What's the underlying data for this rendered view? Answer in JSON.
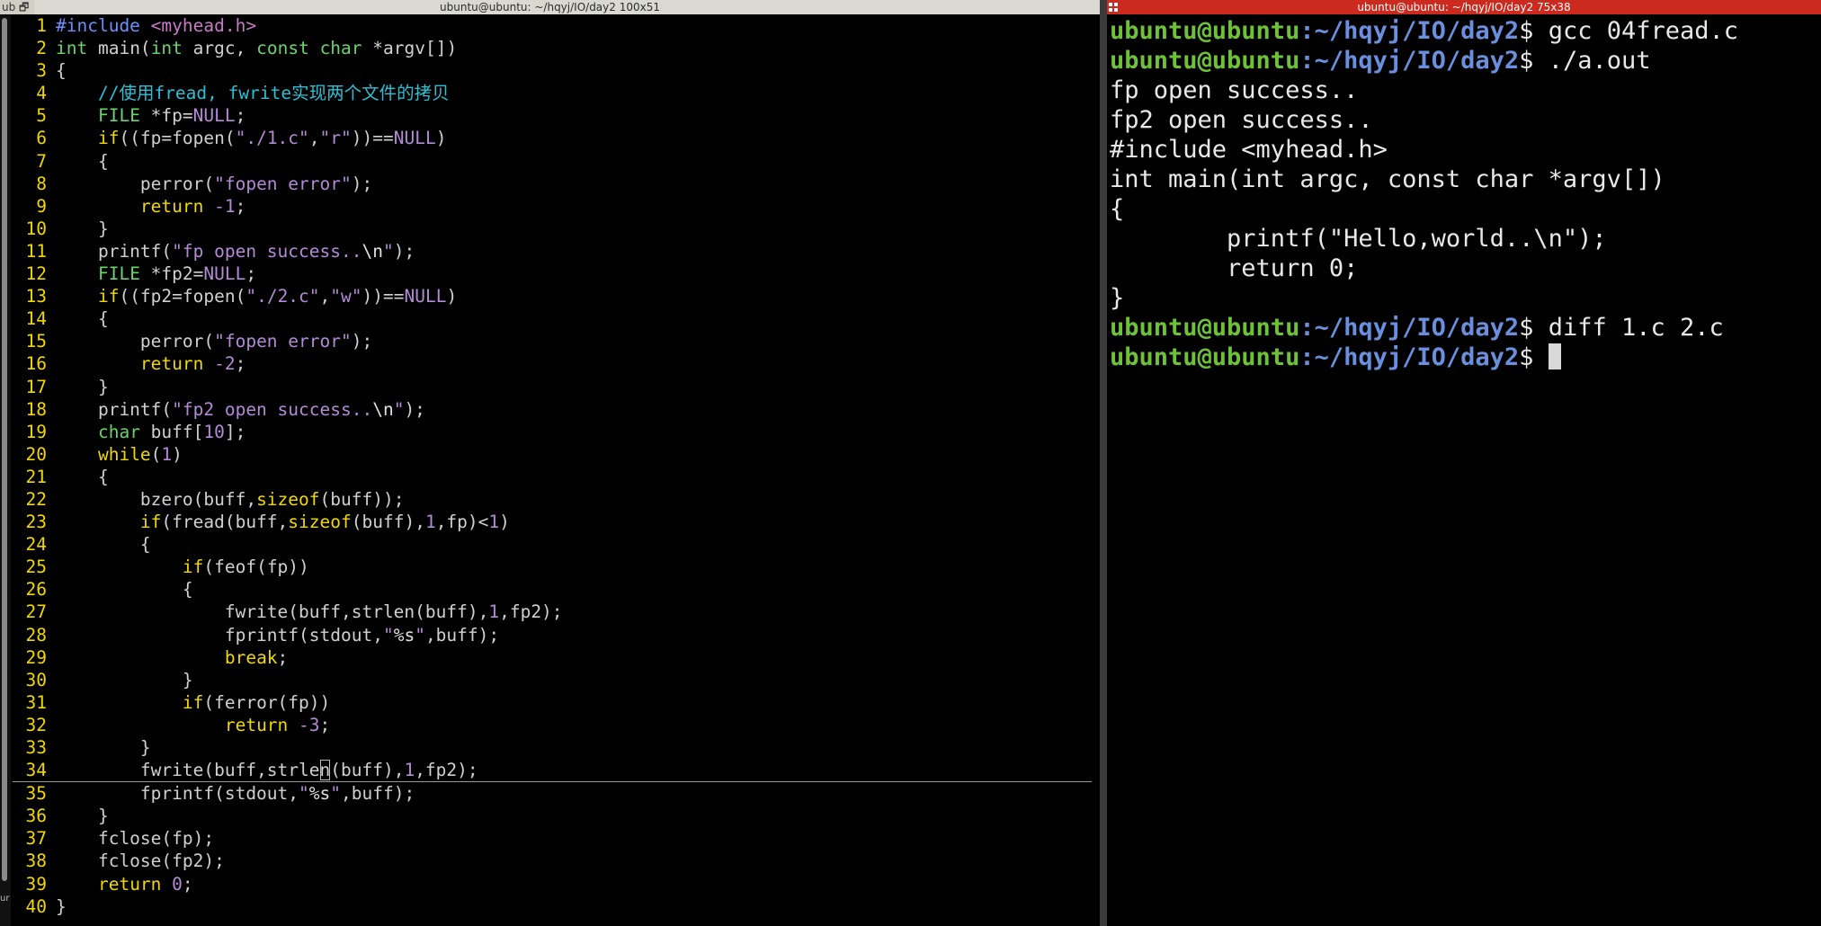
{
  "left_window": {
    "title": "ubuntu@ubuntu: ~/hqyj/IO/day2 100x51",
    "corner_label": "ub 🗗",
    "side_label": "ur",
    "lines": [
      [
        {
          "t": "#include ",
          "c": "pre"
        },
        {
          "t": "<myhead.h>",
          "c": "inc"
        }
      ],
      [
        {
          "t": "int",
          "c": "typ"
        },
        {
          "t": " main(",
          "c": ""
        },
        {
          "t": "int",
          "c": "typ"
        },
        {
          "t": " argc, ",
          "c": ""
        },
        {
          "t": "const",
          "c": "typ"
        },
        {
          "t": " ",
          "c": ""
        },
        {
          "t": "char",
          "c": "typ"
        },
        {
          "t": " *argv[])",
          "c": ""
        }
      ],
      [
        {
          "t": "{",
          "c": ""
        }
      ],
      [
        {
          "t": "    ",
          "c": ""
        },
        {
          "t": "//使用fread, fwrite实现两个文件的拷贝",
          "c": "cmt"
        }
      ],
      [
        {
          "t": "    ",
          "c": ""
        },
        {
          "t": "FILE",
          "c": "typ"
        },
        {
          "t": " *fp=",
          "c": ""
        },
        {
          "t": "NULL",
          "c": "num"
        },
        {
          "t": ";",
          "c": ""
        }
      ],
      [
        {
          "t": "    ",
          "c": ""
        },
        {
          "t": "if",
          "c": "kw"
        },
        {
          "t": "((fp=fopen(",
          "c": ""
        },
        {
          "t": "\"./1.c\"",
          "c": "str"
        },
        {
          "t": ",",
          "c": ""
        },
        {
          "t": "\"r\"",
          "c": "str"
        },
        {
          "t": "))==",
          "c": ""
        },
        {
          "t": "NULL",
          "c": "num"
        },
        {
          "t": ")",
          "c": ""
        }
      ],
      [
        {
          "t": "    {",
          "c": ""
        }
      ],
      [
        {
          "t": "        perror(",
          "c": ""
        },
        {
          "t": "\"fopen error\"",
          "c": "str"
        },
        {
          "t": ");",
          "c": ""
        }
      ],
      [
        {
          "t": "        ",
          "c": ""
        },
        {
          "t": "return",
          "c": "kw"
        },
        {
          "t": " ",
          "c": ""
        },
        {
          "t": "-1",
          "c": "num"
        },
        {
          "t": ";",
          "c": ""
        }
      ],
      [
        {
          "t": "    }",
          "c": ""
        }
      ],
      [
        {
          "t": "    printf(",
          "c": ""
        },
        {
          "t": "\"fp open success..",
          "c": "str"
        },
        {
          "t": "\\n",
          "c": "esc"
        },
        {
          "t": "\"",
          "c": "str"
        },
        {
          "t": ");",
          "c": ""
        }
      ],
      [
        {
          "t": "    ",
          "c": ""
        },
        {
          "t": "FILE",
          "c": "typ"
        },
        {
          "t": " *fp2=",
          "c": ""
        },
        {
          "t": "NULL",
          "c": "num"
        },
        {
          "t": ";",
          "c": ""
        }
      ],
      [
        {
          "t": "    ",
          "c": ""
        },
        {
          "t": "if",
          "c": "kw"
        },
        {
          "t": "((fp2=fopen(",
          "c": ""
        },
        {
          "t": "\"./2.c\"",
          "c": "str"
        },
        {
          "t": ",",
          "c": ""
        },
        {
          "t": "\"w\"",
          "c": "str"
        },
        {
          "t": "))==",
          "c": ""
        },
        {
          "t": "NULL",
          "c": "num"
        },
        {
          "t": ")",
          "c": ""
        }
      ],
      [
        {
          "t": "    {",
          "c": ""
        }
      ],
      [
        {
          "t": "        perror(",
          "c": ""
        },
        {
          "t": "\"fopen error\"",
          "c": "str"
        },
        {
          "t": ");",
          "c": ""
        }
      ],
      [
        {
          "t": "        ",
          "c": ""
        },
        {
          "t": "return",
          "c": "kw"
        },
        {
          "t": " ",
          "c": ""
        },
        {
          "t": "-2",
          "c": "num"
        },
        {
          "t": ";",
          "c": ""
        }
      ],
      [
        {
          "t": "    }",
          "c": ""
        }
      ],
      [
        {
          "t": "    printf(",
          "c": ""
        },
        {
          "t": "\"fp2 open success..",
          "c": "str"
        },
        {
          "t": "\\n",
          "c": "esc"
        },
        {
          "t": "\"",
          "c": "str"
        },
        {
          "t": ");",
          "c": ""
        }
      ],
      [
        {
          "t": "    ",
          "c": ""
        },
        {
          "t": "char",
          "c": "typ"
        },
        {
          "t": " buff[",
          "c": ""
        },
        {
          "t": "10",
          "c": "num"
        },
        {
          "t": "];",
          "c": ""
        }
      ],
      [
        {
          "t": "    ",
          "c": ""
        },
        {
          "t": "while",
          "c": "kw"
        },
        {
          "t": "(",
          "c": ""
        },
        {
          "t": "1",
          "c": "num"
        },
        {
          "t": ")",
          "c": ""
        }
      ],
      [
        {
          "t": "    {",
          "c": ""
        }
      ],
      [
        {
          "t": "        bzero(buff,",
          "c": ""
        },
        {
          "t": "sizeof",
          "c": "kw"
        },
        {
          "t": "(buff));",
          "c": ""
        }
      ],
      [
        {
          "t": "        ",
          "c": ""
        },
        {
          "t": "if",
          "c": "kw"
        },
        {
          "t": "(fread(buff,",
          "c": ""
        },
        {
          "t": "sizeof",
          "c": "kw"
        },
        {
          "t": "(buff),",
          "c": ""
        },
        {
          "t": "1",
          "c": "num"
        },
        {
          "t": ",fp)<",
          "c": ""
        },
        {
          "t": "1",
          "c": "num"
        },
        {
          "t": ")",
          "c": ""
        }
      ],
      [
        {
          "t": "        {",
          "c": ""
        }
      ],
      [
        {
          "t": "            ",
          "c": ""
        },
        {
          "t": "if",
          "c": "kw"
        },
        {
          "t": "(feof(fp))",
          "c": ""
        }
      ],
      [
        {
          "t": "            {",
          "c": ""
        }
      ],
      [
        {
          "t": "                fwrite(buff,strlen(buff),",
          "c": ""
        },
        {
          "t": "1",
          "c": "num"
        },
        {
          "t": ",fp2);",
          "c": ""
        }
      ],
      [
        {
          "t": "                fprintf(stdout,",
          "c": ""
        },
        {
          "t": "\"",
          "c": "str"
        },
        {
          "t": "%s",
          "c": "esc"
        },
        {
          "t": "\"",
          "c": "str"
        },
        {
          "t": ",buff);",
          "c": ""
        }
      ],
      [
        {
          "t": "                ",
          "c": ""
        },
        {
          "t": "break",
          "c": "kw"
        },
        {
          "t": ";",
          "c": ""
        }
      ],
      [
        {
          "t": "            }",
          "c": ""
        }
      ],
      [
        {
          "t": "            ",
          "c": ""
        },
        {
          "t": "if",
          "c": "kw"
        },
        {
          "t": "(ferror(fp))",
          "c": ""
        }
      ],
      [
        {
          "t": "                ",
          "c": ""
        },
        {
          "t": "return",
          "c": "kw"
        },
        {
          "t": " ",
          "c": ""
        },
        {
          "t": "-3",
          "c": "num"
        },
        {
          "t": ";",
          "c": ""
        }
      ],
      [
        {
          "t": "        }",
          "c": ""
        }
      ],
      [
        {
          "t": "        fwrite(buff,strle",
          "c": ""
        },
        {
          "t": "n",
          "c": "cur"
        },
        {
          "t": "(buff),",
          "c": ""
        },
        {
          "t": "1",
          "c": "num"
        },
        {
          "t": ",fp2);",
          "c": ""
        }
      ],
      [
        {
          "t": "        fprintf(stdout,",
          "c": ""
        },
        {
          "t": "\"",
          "c": "str"
        },
        {
          "t": "%s",
          "c": "esc"
        },
        {
          "t": "\"",
          "c": "str"
        },
        {
          "t": ",buff);",
          "c": ""
        }
      ],
      [
        {
          "t": "    }",
          "c": ""
        }
      ],
      [
        {
          "t": "    fclose(fp);",
          "c": ""
        }
      ],
      [
        {
          "t": "    fclose(fp2);",
          "c": ""
        }
      ],
      [
        {
          "t": "    ",
          "c": ""
        },
        {
          "t": "return",
          "c": "kw"
        },
        {
          "t": " ",
          "c": ""
        },
        {
          "t": "0",
          "c": "num"
        },
        {
          "t": ";",
          "c": ""
        }
      ],
      [
        {
          "t": "}",
          "c": ""
        }
      ]
    ],
    "cursor_line": 34
  },
  "right_window": {
    "title": "ubuntu@ubuntu: ~/hqyj/IO/day2 75x38",
    "prompt_user": "ubuntu@ubuntu",
    "prompt_sep": ":",
    "prompt_path": "~/hqyj/IO/day2",
    "prompt_dollar": "$ ",
    "lines": [
      {
        "prompt": true,
        "text": "gcc 04fread.c"
      },
      {
        "prompt": true,
        "text": "./a.out"
      },
      {
        "prompt": false,
        "text": "fp open success.."
      },
      {
        "prompt": false,
        "text": "fp2 open success.."
      },
      {
        "prompt": false,
        "text": "#include <myhead.h>"
      },
      {
        "prompt": false,
        "text": "int main(int argc, const char *argv[])"
      },
      {
        "prompt": false,
        "text": "{"
      },
      {
        "prompt": false,
        "text": "        printf(\"Hello,world..\\n\");"
      },
      {
        "prompt": false,
        "text": "        return 0;"
      },
      {
        "prompt": false,
        "text": "}"
      },
      {
        "prompt": true,
        "text": "diff 1.c 2.c"
      },
      {
        "prompt": true,
        "text": "",
        "cursor": true
      }
    ]
  }
}
